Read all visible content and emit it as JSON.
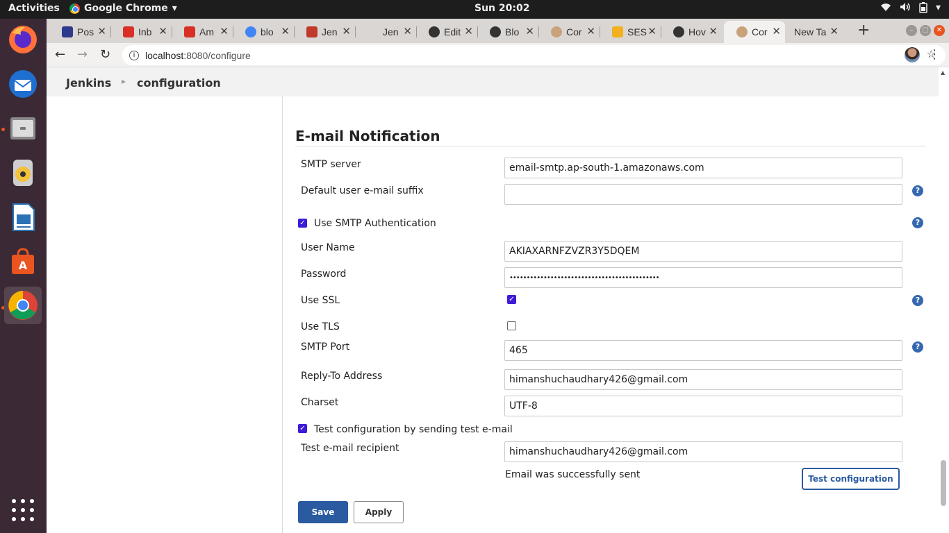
{
  "topbar": {
    "activities": "Activities",
    "app_name": "Google Chrome",
    "clock": "Sun 20:02"
  },
  "dock": {
    "apps": [
      "firefox-icon",
      "thunderbird-icon",
      "files-icon",
      "rhythmbox-icon",
      "libreoffice-writer-icon",
      "software-center-icon",
      "chrome-icon"
    ]
  },
  "tabs": [
    {
      "title": "Pos",
      "favicon_color": "#2d3a8c"
    },
    {
      "title": "Inb",
      "favicon_color": "#d93025"
    },
    {
      "title": "Am",
      "favicon_color": "#d93025"
    },
    {
      "title": "blo",
      "favicon_color": "#4285f4"
    },
    {
      "title": "Jen",
      "favicon_color": "#c0392b"
    },
    {
      "title": "Jen",
      "favicon_color": "#dad6d3"
    },
    {
      "title": "Edit",
      "favicon_color": "#333333"
    },
    {
      "title": "Blo",
      "favicon_color": "#333333"
    },
    {
      "title": "Cor",
      "favicon_color": "#c9a27a"
    },
    {
      "title": "SES",
      "favicon_color": "#f2b01e"
    },
    {
      "title": "Hov",
      "favicon_color": "#333333"
    },
    {
      "title": "Cor",
      "favicon_color": "#c9a27a"
    },
    {
      "title": "New Ta",
      "favicon_color": "#dad6d3"
    }
  ],
  "url": {
    "host": "localhost",
    "path": ":8080/configure"
  },
  "breadcrumb": {
    "root": "Jenkins",
    "current": "configuration"
  },
  "section": {
    "title": "E-mail Notification"
  },
  "form": {
    "smtp_server_label": "SMTP server",
    "smtp_server_value": "email-smtp.ap-south-1.amazonaws.com",
    "suffix_label": "Default user e-mail suffix",
    "suffix_value": "",
    "smtp_auth_label": "Use SMTP Authentication",
    "username_label": "User Name",
    "username_value": "AKIAXARNFZVZR3Y5DQEM",
    "password_label": "Password",
    "password_value": "••••••••••••••••••••••••••••••••••••••••••••",
    "ssl_label": "Use SSL",
    "tls_label": "Use TLS",
    "port_label": "SMTP Port",
    "port_value": "465",
    "reply_to_label": "Reply-To Address",
    "reply_to_value": "himanshuchaudhary426@gmail.com",
    "charset_label": "Charset",
    "charset_value": "UTF-8",
    "test_config_label": "Test configuration by sending test e-mail",
    "test_recipient_label": "Test e-mail recipient",
    "test_recipient_value": "himanshuchaudhary426@gmail.com",
    "success_message": "Email was successfully sent",
    "test_button": "Test configuration",
    "save_button": "Save",
    "apply_button": "Apply"
  },
  "checkboxes": {
    "smtp_auth": true,
    "ssl": true,
    "tls": false,
    "test_config": true
  },
  "colors": {
    "accent_blue": "#2a5aa0",
    "checkbox": "#3e1bd8",
    "dock_bg": "#3b2a35"
  }
}
